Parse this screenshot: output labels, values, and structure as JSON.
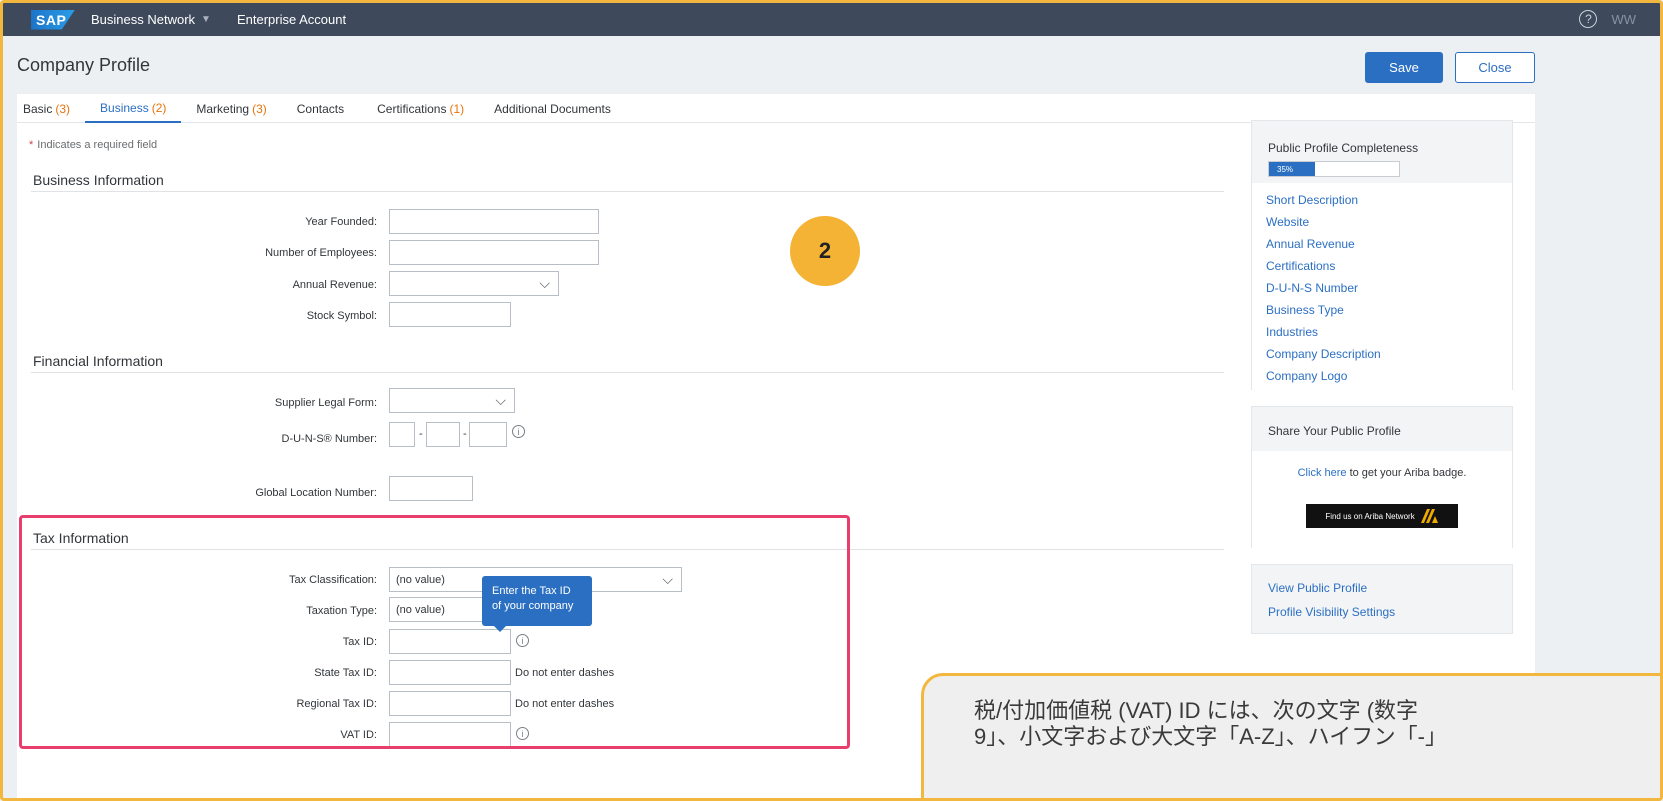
{
  "shell": {
    "logo": "SAP",
    "product": "Business Network",
    "account": "Enterprise Account",
    "help_glyph": "?",
    "user_initials": "WW"
  },
  "header": {
    "title": "Company Profile",
    "save_label": "Save",
    "close_label": "Close"
  },
  "tabs": [
    {
      "label": "Basic",
      "count": "(3)"
    },
    {
      "label": "Business",
      "count": "(2)"
    },
    {
      "label": "Marketing",
      "count": "(3)"
    },
    {
      "label": "Contacts",
      "count": ""
    },
    {
      "label": "Certifications",
      "count": "(1)"
    },
    {
      "label": "Additional Documents",
      "count": ""
    }
  ],
  "required_note": "Indicates a required field",
  "business_info": {
    "title": "Business Information",
    "year_founded_label": "Year Founded:",
    "employees_label": "Number of Employees:",
    "revenue_label": "Annual Revenue:",
    "stock_label": "Stock Symbol:"
  },
  "financial_info": {
    "title": "Financial Information",
    "legal_form_label": "Supplier Legal Form:",
    "duns_label": "D-U-N-S® Number:",
    "gln_label": "Global Location Number:"
  },
  "tax_info": {
    "title": "Tax Information",
    "classification_label": "Tax Classification:",
    "classification_value": "(no value)",
    "taxation_type_label": "Taxation Type:",
    "taxation_type_value": "(no value)",
    "tax_id_label": "Tax ID:",
    "state_tax_label": "State Tax ID:",
    "state_tax_hint": "Do not enter dashes",
    "regional_tax_label": "Regional Tax ID:",
    "regional_tax_hint": "Do not enter dashes",
    "vat_label": "VAT ID:"
  },
  "tooltip": {
    "line1": "Enter the Tax ID",
    "line2": "of your company"
  },
  "completeness": {
    "title": "Public Profile Completeness",
    "percent_label": "35%",
    "percent": 35,
    "links": [
      "Short Description",
      "Website",
      "Annual Revenue",
      "Certifications",
      "D-U-N-S Number",
      "Business Type",
      "Industries",
      "Company Description",
      "Company Logo"
    ]
  },
  "share": {
    "title": "Share Your Public Profile",
    "link_text": "Click here",
    "rest_text": " to get your Ariba badge.",
    "badge_text": "Find us on Ariba Network"
  },
  "profile_links": {
    "view": "View Public Profile",
    "visibility": "Profile Visibility Settings"
  },
  "step_number": "2",
  "callout": {
    "line1": "税/付加価値税 (VAT) ID には、次の文字 (数字",
    "line2": "9」、小文字および大文字「A-Z」、ハイフン「-」"
  },
  "colors": {
    "accent": "#2b6fc2",
    "highlight": "#e83e6c",
    "step_circle": "#f5b335",
    "frame": "#f2b73f"
  }
}
